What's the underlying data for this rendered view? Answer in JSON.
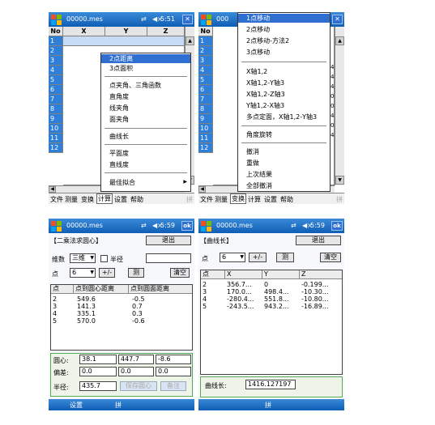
{
  "colors": {
    "titlebar": "#1f6fc9",
    "selection": "#2f6fd2",
    "panel_border": "#55aa55"
  },
  "screen1": {
    "title": "00000.mes",
    "time": "5:51",
    "close": "✕",
    "headers": [
      "No",
      "X",
      "Y",
      "Z"
    ],
    "rows": [
      "1",
      "2",
      "3",
      "4",
      "5",
      "6",
      "7",
      "8",
      "9",
      "10",
      "11",
      "12"
    ],
    "menu": [
      "2点距离",
      "3点面积",
      "点夹角、三角函数",
      "直角度",
      "线夹角",
      "面夹角",
      "曲线长",
      "平面度",
      "直线度",
      "最佳拟合"
    ],
    "menubar": [
      "文件",
      "测量",
      "变换",
      "计算",
      "设置",
      "帮助"
    ],
    "kbd": "拼"
  },
  "screen2": {
    "title": "000",
    "time": "5:51",
    "close": "✕",
    "headers": [
      "No"
    ],
    "rows": [
      "1",
      "2",
      "3",
      "4",
      "5",
      "6",
      "7",
      "8",
      "9",
      "10",
      "11",
      "12"
    ],
    "edge_digits": [
      "4",
      "4",
      "4",
      "0",
      "0",
      "4",
      "0",
      "4"
    ],
    "menu": [
      "1点移动",
      "2点移动",
      "2点移动-方法2",
      "3点移动",
      "X轴1,2",
      "X轴1,2-Y轴3",
      "X轴1,2-Z轴3",
      "Y轴1,2-X轴3",
      "多点定面，X轴1,2-Y轴3",
      "角度旋转",
      "撤消",
      "重做",
      "上次结果",
      "全部撤消"
    ],
    "menubar": [
      "文件",
      "测量",
      "变换",
      "计算",
      "设置",
      "帮助"
    ],
    "kbd": "拼"
  },
  "screen3": {
    "title": "00000.mes",
    "time": "5:59",
    "ok": "ok",
    "heading": "【二乘法求圆心】",
    "exit": "退出",
    "dim_label": "维数",
    "dim_value": "三维",
    "radius_label": "半径",
    "point_label": "点",
    "point_value": "6",
    "pm": "+/-",
    "measure": "测",
    "clear": "清空",
    "col_headers": [
      "点",
      "点到圆心距离",
      "点到圆面距离"
    ],
    "list_rows": [
      [
        "2",
        "549.6",
        "-0.5"
      ],
      [
        "3",
        "141.3",
        "0.7"
      ],
      [
        "4",
        "335.1",
        "0.3"
      ],
      [
        "5",
        "570.0",
        "-0.6"
      ]
    ],
    "center_label": "圆心:",
    "center": [
      "38.1",
      "447.7",
      "-8.6"
    ],
    "dev_label": "偏差:",
    "dev": [
      "0.0",
      "0.0",
      "0.0"
    ],
    "r_label": "半径:",
    "r_value": "435.7",
    "btn_save": "保存圆心",
    "btn_note": "备注",
    "soft_left": "设置",
    "soft_mid": "拼"
  },
  "screen4": {
    "title": "00000.mes",
    "time": "5:59",
    "ok": "ok",
    "heading": "【曲线长】",
    "exit": "退出",
    "point_label": "点",
    "point_value": "6",
    "pm": "+/-",
    "measure": "测",
    "clear": "清空",
    "col_headers": [
      "点",
      "X",
      "Y",
      "Z"
    ],
    "list_rows": [
      [
        "2",
        "356.7...",
        "0",
        "-0.199..."
      ],
      [
        "3",
        "170.0...",
        "498.4...",
        "-10.30..."
      ],
      [
        "4",
        "-280.4...",
        "551.8...",
        "-10.80..."
      ],
      [
        "5",
        "-243.5...",
        "943.2...",
        "-16.89..."
      ]
    ],
    "len_label": "曲线长:",
    "len_value": "1416.127197",
    "soft_mid": "拼"
  }
}
